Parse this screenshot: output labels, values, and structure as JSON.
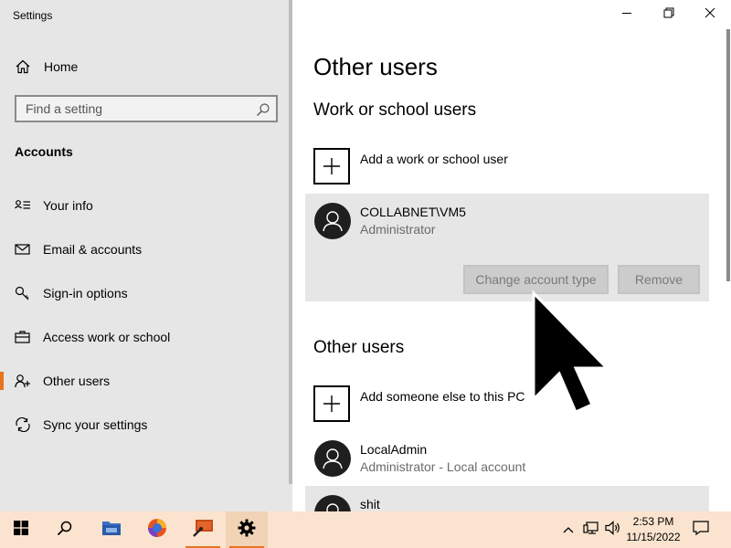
{
  "app": {
    "title": "Settings"
  },
  "window_controls": {
    "minimize": "minimize-icon",
    "restore": "restore-icon",
    "close": "close-icon"
  },
  "sidebar": {
    "home_label": "Home",
    "search_placeholder": "Find a setting",
    "section_heading": "Accounts",
    "items": [
      {
        "label": "Your info",
        "icon": "person-card-icon",
        "selected": false
      },
      {
        "label": "Email & accounts",
        "icon": "mail-icon",
        "selected": false
      },
      {
        "label": "Sign-in options",
        "icon": "key-icon",
        "selected": false
      },
      {
        "label": "Access work or school",
        "icon": "briefcase-icon",
        "selected": false
      },
      {
        "label": "Other users",
        "icon": "person-add-icon",
        "selected": true
      },
      {
        "label": "Sync your settings",
        "icon": "sync-icon",
        "selected": false
      }
    ],
    "accent": "#e8741e"
  },
  "main": {
    "page_title": "Other users",
    "work_section": {
      "title": "Work or school users",
      "add_label": "Add a work or school user",
      "account": {
        "name": "COLLABNET\\VM5",
        "role": "Administrator",
        "change_button": "Change account type",
        "remove_button": "Remove"
      }
    },
    "other_section": {
      "title": "Other users",
      "add_label": "Add someone else to this PC",
      "accounts": [
        {
          "name": "LocalAdmin",
          "role": "Administrator - Local account"
        },
        {
          "name": "shit",
          "role": ""
        }
      ]
    }
  },
  "taskbar": {
    "apps": [
      {
        "name": "start",
        "icon": "windows-logo-icon"
      },
      {
        "name": "search",
        "icon": "search-icon"
      },
      {
        "name": "file-explorer",
        "icon": "folder-icon"
      },
      {
        "name": "browser",
        "icon": "browser-icon"
      },
      {
        "name": "app",
        "icon": "app-icon"
      },
      {
        "name": "settings",
        "icon": "gear-icon",
        "active": true
      }
    ],
    "clock": {
      "time": "2:53 PM",
      "date": "11/15/2022"
    }
  }
}
